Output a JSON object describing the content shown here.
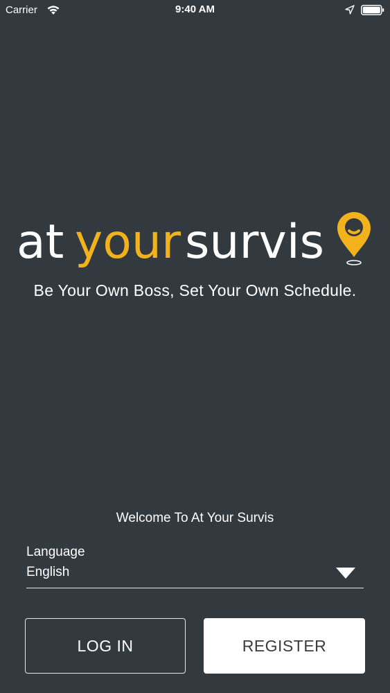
{
  "status_bar": {
    "carrier": "Carrier",
    "time": "9:40 AM",
    "wifi_icon": "wifi-icon",
    "location_icon": "location-arrow-icon",
    "battery_icon": "battery-icon"
  },
  "brand": {
    "logo_part1": "at",
    "logo_part2": "your",
    "logo_part3": "survis",
    "logo_icon": "map-pin-icon",
    "tagline": "Be Your Own Boss, Set Your Own Schedule.",
    "accent_color": "#f2b21d",
    "background_color": "#323a40"
  },
  "welcome": {
    "text": "Welcome To At Your Survis"
  },
  "language": {
    "label": "Language",
    "selected": "English",
    "chevron_icon": "chevron-down-icon"
  },
  "actions": {
    "login_label": "LOG IN",
    "register_label": "REGISTER"
  }
}
